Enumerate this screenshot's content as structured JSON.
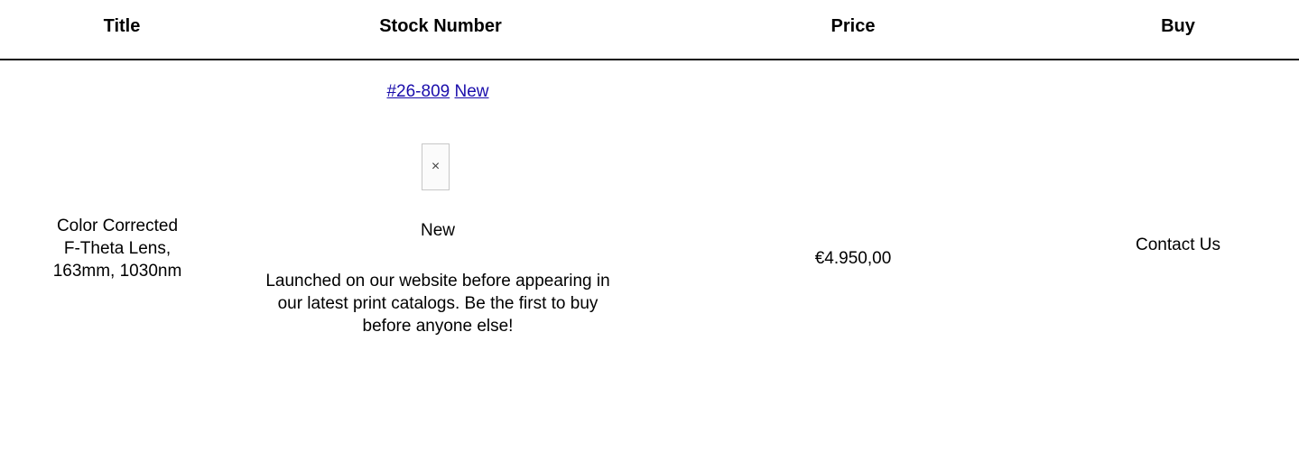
{
  "table": {
    "headers": {
      "title": "Title",
      "stock_number": "Stock Number",
      "price": "Price",
      "buy": "Buy"
    },
    "rows": [
      {
        "title_lines": [
          "Color Corrected",
          "F-Theta Lens,",
          "163mm, 1030nm"
        ],
        "stock_link": "#26-809",
        "new_link": "New",
        "image_icon": "broken-image-icon",
        "image_glyph": "×",
        "status_label": "New",
        "status_description": "Launched on our website before appearing in our latest print catalogs. Be the first to buy before anyone else!",
        "price": "€4.950,00",
        "buy_label": "Contact Us"
      }
    ]
  },
  "colors": {
    "link": "#1a0dab",
    "rule": "#111111"
  }
}
